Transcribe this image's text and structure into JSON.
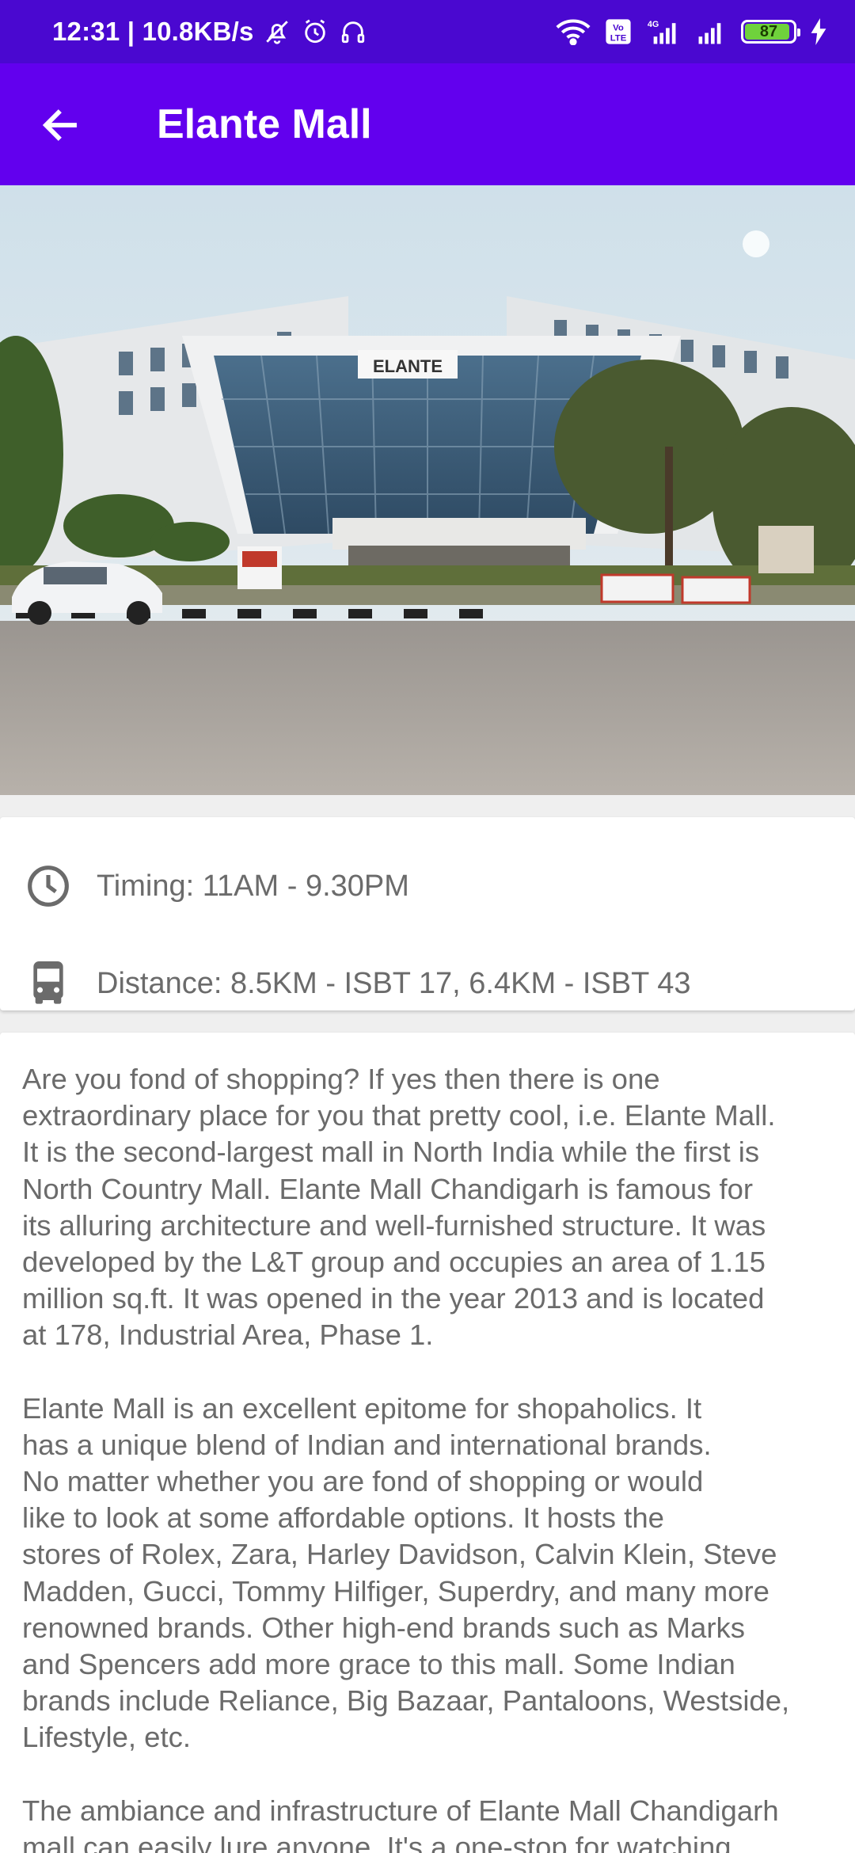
{
  "status_bar": {
    "time_speed": "12:31 | 10.8KB/s",
    "battery_level": "87",
    "network_label_volte": "Vo LTE",
    "network_label_4g": "4G"
  },
  "app_bar": {
    "title": "Elante Mall"
  },
  "hero": {
    "sign_text": "ELANTE"
  },
  "info": {
    "timing": "Timing: 11AM - 9.30PM",
    "distance": "Distance: 8.5KM - ISBT 17, 6.4KM - ISBT 43"
  },
  "description": {
    "p1": "Are you fond of shopping? If yes then there is one\nextraordinary place for you that pretty cool, i.e. Elante Mall.\nIt is the second-largest mall in North India while the first is\nNorth Country Mall. Elante Mall Chandigarh is famous for\nits alluring architecture and well-furnished structure. It was\ndeveloped by the L&T group and occupies an area of 1.15\nmillion sq.ft. It was opened in the year 2013 and is located\nat 178, Industrial Area, Phase 1.",
    "p2": "Elante Mall is an excellent epitome for shopaholics. It\nhas a unique blend of Indian and international brands.\nNo matter whether you are fond of shopping or would\nlike to look at some affordable options. It hosts the\nstores of Rolex, Zara, Harley Davidson, Calvin Klein, Steve\nMadden, Gucci, Tommy Hilfiger, Superdry, and many more\nrenowned brands. Other high-end brands such as Marks\nand Spencers add more grace to this mall. Some Indian\nbrands include Reliance, Big Bazaar, Pantaloons, Westside,\nLifestyle, etc.",
    "p3": "The ambiance and infrastructure of Elante Mall Chandigarh\nmall can easily lure anyone. It's a one-stop for watching"
  },
  "colors": {
    "status_bar": "#4a08d0",
    "app_bar": "#6200ee",
    "body_text": "#6b6b6b",
    "background": "#efefef"
  },
  "icons": {
    "back": "arrow-back-icon",
    "timing": "clock-icon",
    "distance": "bus-icon"
  }
}
